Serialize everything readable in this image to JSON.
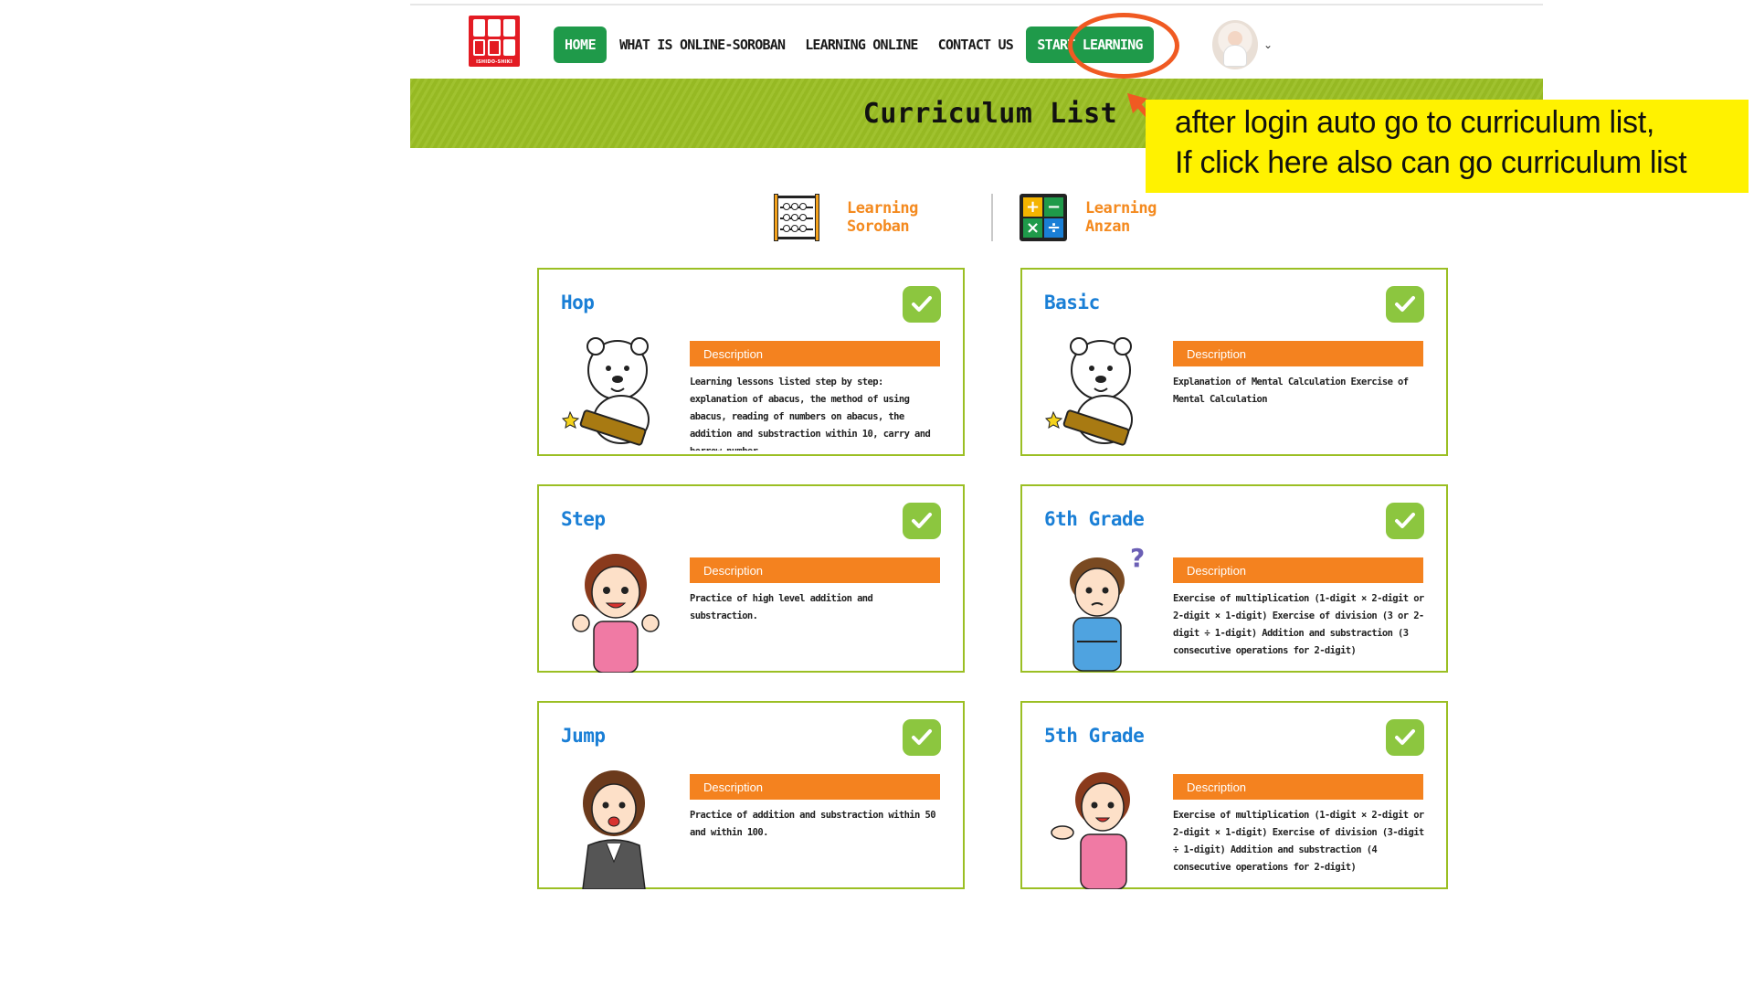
{
  "header": {
    "logo_text": "ISHIDO-SHIKI",
    "nav": {
      "home": "HOME",
      "what_is": "WHAT IS ONLINE-SOROBAN",
      "learning_online": "LEARNING ONLINE",
      "contact": "CONTACT US",
      "start": "START LEARNING"
    },
    "user_menu_caret": "⌄"
  },
  "banner": {
    "title": "Curriculum List"
  },
  "categories": [
    {
      "line1": "Learning",
      "line2": "Soroban",
      "icon": "abacus-icon"
    },
    {
      "line1": "Learning",
      "line2": "Anzan",
      "icon": "calculator-icon"
    }
  ],
  "cards": [
    {
      "title": "Hop",
      "desc_label": "Description",
      "text": "Learning lessons listed step by step: explanation of abacus, the method of using abacus, reading of numbers on abacus, the addition and substraction within 10, carry and borrow number.",
      "completed": true
    },
    {
      "title": "Basic",
      "desc_label": "Description",
      "text": "Explanation of Mental Calculation Exercise of Mental Calculation",
      "completed": true
    },
    {
      "title": "Step",
      "desc_label": "Description",
      "text": "Practice of high level addition and substraction.",
      "completed": true
    },
    {
      "title": "6th Grade",
      "desc_label": "Description",
      "text": "Exercise of multiplication (1-digit × 2-digit or 2-digit × 1-digit) Exercise of division (3 or 2-digit ÷ 1-digit) Addition and substraction (3 consecutive operations for 2-digit)",
      "completed": true
    },
    {
      "title": "Jump",
      "desc_label": "Description",
      "text": "Practice of addition and substraction within 50 and within 100.",
      "completed": true
    },
    {
      "title": "5th Grade",
      "desc_label": "Description",
      "text": "Exercise of multiplication (1-digit × 2-digit or 2-digit × 1-digit) Exercise of division (3-digit ÷ 1-digit) Addition and substraction (4 consecutive operations for 2-digit)",
      "completed": true
    }
  ],
  "annotation": {
    "line1": "after login auto go to curriculum list,",
    "line2": "If click here also can go curriculum list"
  },
  "colors": {
    "nav_green": "#1f9a4a",
    "banner_green": "#9bbf24",
    "card_title_blue": "#1a7fd6",
    "accent_orange": "#f4821f",
    "check_green": "#8cc63f",
    "annotation_yellow": "#fff200",
    "annotation_red": "#f05a22"
  }
}
